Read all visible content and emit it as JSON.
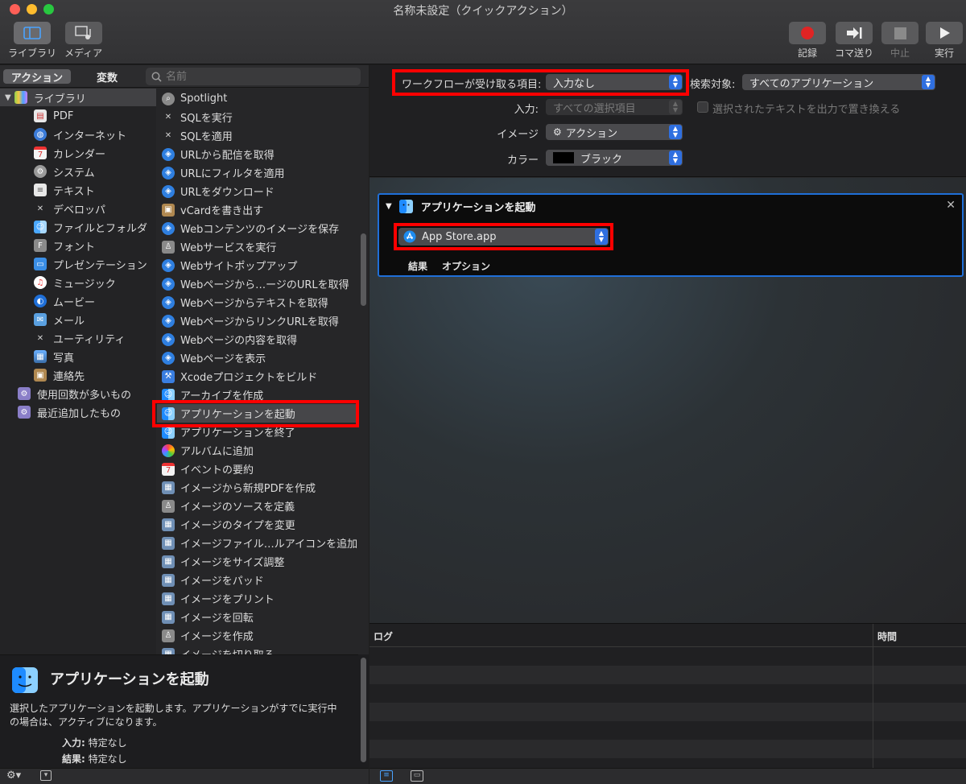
{
  "window": {
    "title": "名称未設定（クイックアクション）"
  },
  "toolbar": {
    "library_label": "ライブラリ",
    "media_label": "メディア",
    "record_label": "記録",
    "step_label": "コマ送り",
    "stop_label": "中止",
    "run_label": "実行"
  },
  "leftpane": {
    "segments": {
      "actions": "アクション",
      "variables": "変数"
    },
    "search": {
      "placeholder": "名前"
    },
    "library": {
      "root": "ライブラリ",
      "items": [
        "PDF",
        "インターネット",
        "カレンダー",
        "システム",
        "テキスト",
        "デベロッパ",
        "ファイルとフォルダ",
        "フォント",
        "プレゼンテーション",
        "ミュージック",
        "ムービー",
        "メール",
        "ユーティリティ",
        "写真",
        "連絡先"
      ],
      "smart": [
        "使用回数が多いもの",
        "最近追加したもの"
      ]
    },
    "actions": [
      "Spotlight",
      "SQLを実行",
      "SQLを適用",
      "URLから配信を取得",
      "URLにフィルタを適用",
      "URLをダウンロード",
      "vCardを書き出す",
      "Webコンテンツのイメージを保存",
      "Webサービスを実行",
      "Webサイトポップアップ",
      "Webページから…ージのURLを取得",
      "Webページからテキストを取得",
      "WebページからリンクURLを取得",
      "Webページの内容を取得",
      "Webページを表示",
      "Xcodeプロジェクトをビルド",
      "アーカイブを作成",
      "アプリケーションを起動",
      "アプリケーションを終了",
      "アルバムに追加",
      "イベントの要約",
      "イメージから新規PDFを作成",
      "イメージのソースを定義",
      "イメージのタイプを変更",
      "イメージファイル…ルアイコンを追加",
      "イメージをサイズ調整",
      "イメージをパッド",
      "イメージをプリント",
      "イメージを回転",
      "イメージを作成",
      "イメージを切り取る"
    ],
    "description": {
      "title": "アプリケーションを起動",
      "body": "選択したアプリケーションを起動します。アプリケーションがすでに実行中の場合は、アクティブになります。",
      "input_key": "入力:",
      "input_val": "特定なし",
      "result_key": "結果:",
      "result_val": "特定なし"
    }
  },
  "workflow": {
    "receives_label": "ワークフローが受け取る項目:",
    "receives_value": "入力なし",
    "search_target_label": "検索対象:",
    "search_target_value": "すべてのアプリケーション",
    "input_label": "入力:",
    "input_value": "すべての選択項目",
    "replace_label": "選択されたテキストを出力で置き換える",
    "image_label": "イメージ",
    "image_value": "アクション",
    "color_label": "カラー",
    "color_value": "ブラック"
  },
  "action_card": {
    "title": "アプリケーションを起動",
    "app_value": "App Store.app",
    "tab_result": "結果",
    "tab_options": "オプション"
  },
  "log": {
    "col_log": "ログ",
    "col_time": "時間"
  }
}
